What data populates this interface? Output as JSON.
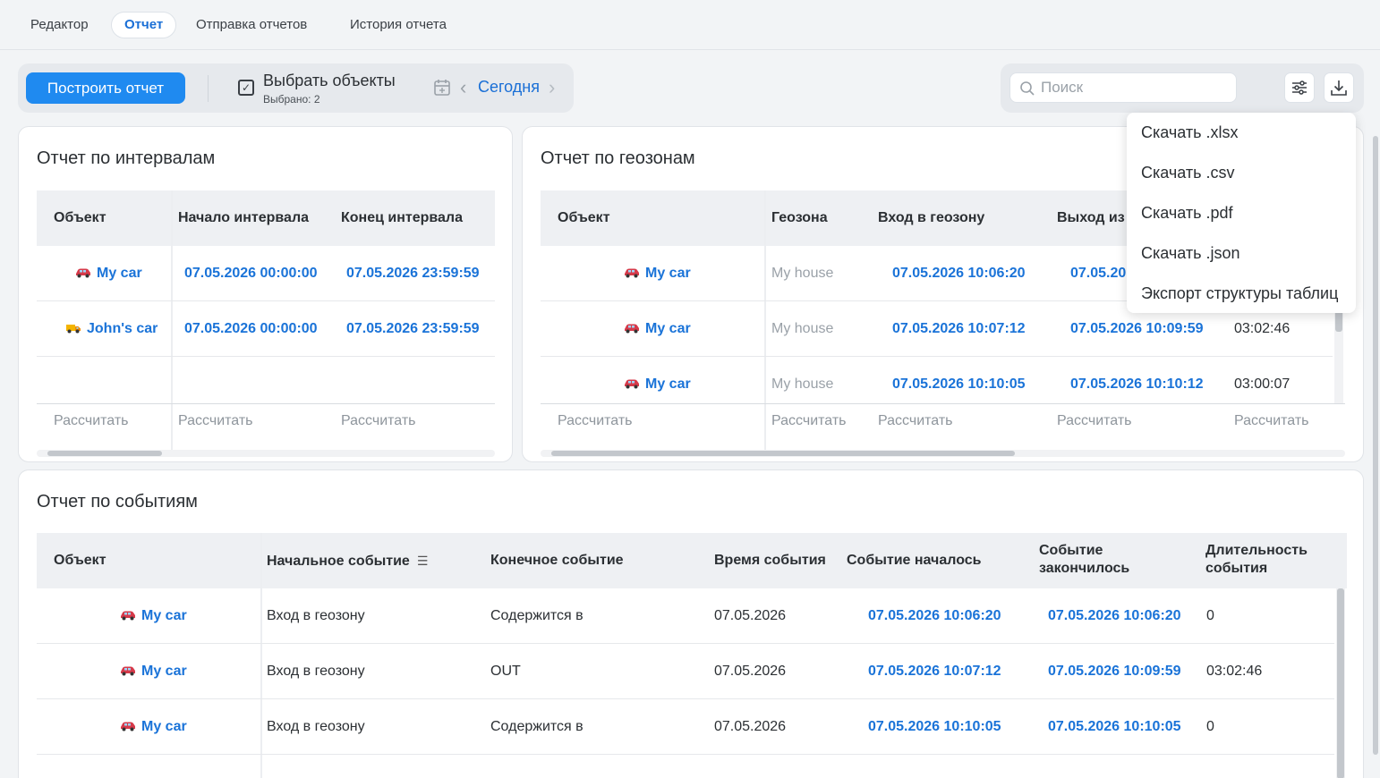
{
  "tabs": [
    {
      "label": "Редактор",
      "active": false
    },
    {
      "label": "Отчет",
      "active": true
    },
    {
      "label": "Отправка отчетов",
      "active": false
    },
    {
      "label": "История отчета",
      "active": false
    }
  ],
  "toolbar": {
    "build_label": "Построить отчет",
    "select_title": "Выбрать объекты",
    "select_sub": "Выбрано: 2",
    "date_label": "Сегодня",
    "search_placeholder": "Поиск"
  },
  "download_menu": [
    "Скачать .xlsx",
    "Скачать .csv",
    "Скачать .pdf",
    "Скачать .json",
    "Экспорт структуры таблиц"
  ],
  "intervals": {
    "title": "Отчет по интервалам",
    "columns": [
      "Объект",
      "Начало интервала",
      "Конец интервала"
    ],
    "rows": [
      {
        "object": "My car",
        "icon": "red-car-icon",
        "start": "07.05.2026 00:00:00",
        "end": "07.05.2026 23:59:59"
      },
      {
        "object": "John's car",
        "icon": "yellow-truck-icon",
        "start": "07.05.2026 00:00:00",
        "end": "07.05.2026 23:59:59"
      }
    ],
    "calc_label": "Рассчитать"
  },
  "geozones": {
    "title": "Отчет по геозонам",
    "columns": [
      "Объект",
      "Геозона",
      "Вход в геозону",
      "Выход из"
    ],
    "rows": [
      {
        "object": "My car",
        "zone": "My house",
        "enter": "07.05.2026 10:06:20",
        "exit": "07.05.20",
        "duration": ""
      },
      {
        "object": "My car",
        "zone": "My house",
        "enter": "07.05.2026 10:07:12",
        "exit": "07.05.2026 10:09:59",
        "duration": "03:02:46"
      },
      {
        "object": "My car",
        "zone": "My house",
        "enter": "07.05.2026 10:10:05",
        "exit": "07.05.2026 10:10:12",
        "duration": "03:00:07"
      }
    ],
    "calc_label": "Рассчитать"
  },
  "events": {
    "title": "Отчет по событиям",
    "columns": [
      "Объект",
      "Начальное событие",
      "Конечное событие",
      "Время события",
      "Событие началось",
      "Событие закончилось",
      "Длительность события"
    ],
    "rows": [
      {
        "object": "My car",
        "start_event": "Вход в геозону",
        "end_event": "Содержится в",
        "date": "07.05.2026",
        "began": "07.05.2026 10:06:20",
        "ended": "07.05.2026 10:06:20",
        "duration": "0"
      },
      {
        "object": "My car",
        "start_event": "Вход в геозону",
        "end_event": "OUT",
        "date": "07.05.2026",
        "began": "07.05.2026 10:07:12",
        "ended": "07.05.2026 10:09:59",
        "duration": "03:02:46"
      },
      {
        "object": "My car",
        "start_event": "Вход в геозону",
        "end_event": "Содержится в",
        "date": "07.05.2026",
        "began": "07.05.2026 10:10:05",
        "ended": "07.05.2026 10:10:05",
        "duration": "0"
      }
    ]
  },
  "colors": {
    "accent": "#1f8af0",
    "link": "#1a73d8",
    "muted": "#9aa1a8"
  }
}
